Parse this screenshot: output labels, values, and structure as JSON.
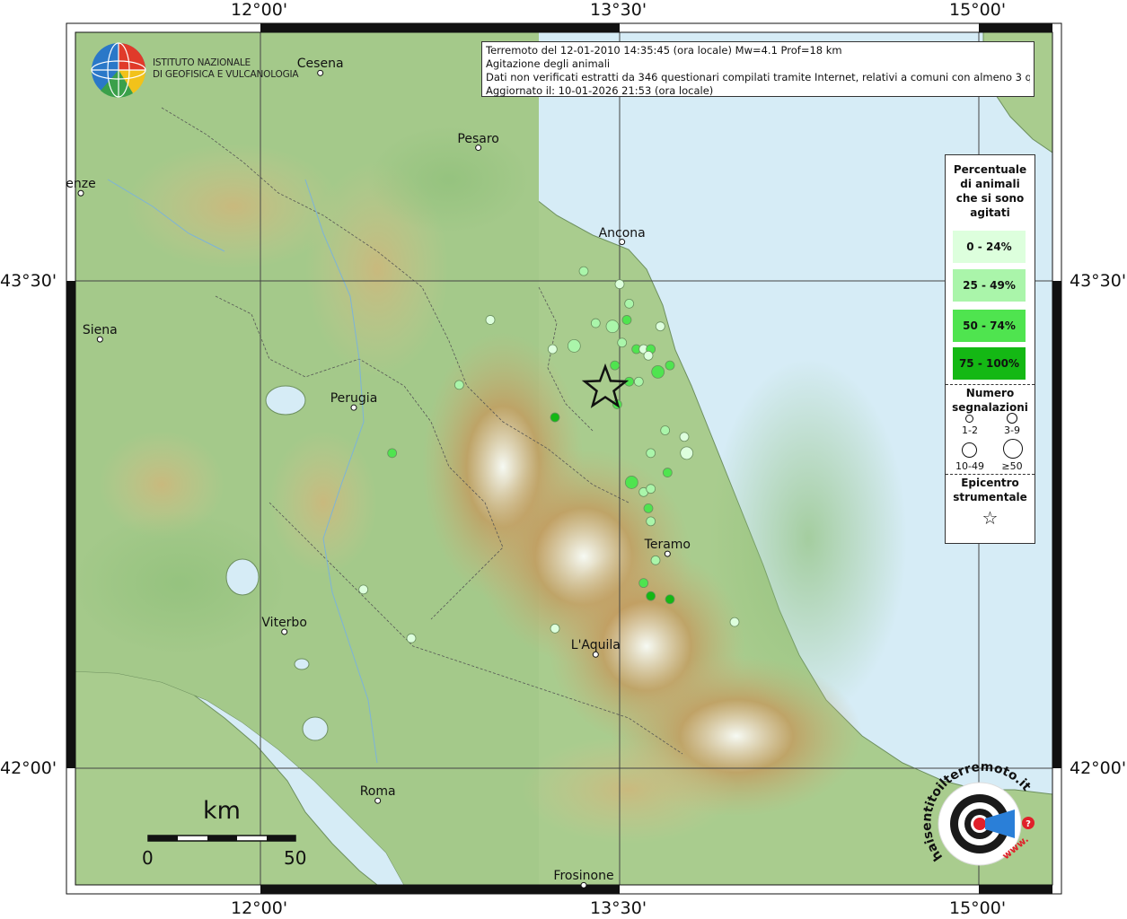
{
  "info": {
    "line1": "Terremoto del 12-01-2010 14:35:45 (ora locale) Mw=4.1 Prof=18 km",
    "line2": "Agitazione degli animali",
    "line3": "Dati non verificati estratti da 346 questionari compilati tramite Internet, relativi a comuni con almeno 3 questionari.",
    "line4": "Aggiornato il: 10-01-2026 21:53 (ora locale)"
  },
  "institute": {
    "line1": "ISTITUTO NAZIONALE",
    "line2": "DI GEOFISICA E VULCANOLOGIA"
  },
  "axes": {
    "top": [
      "12°00'",
      "13°30'",
      "15°00'"
    ],
    "bottom": [
      "12°00'",
      "13°30'",
      "15°00'"
    ],
    "left": [
      "43°30'",
      "42°00'"
    ],
    "right": [
      "43°30'",
      "42°00'"
    ]
  },
  "cities": [
    {
      "name": "Cesena",
      "lon": 12.25,
      "lat": 44.14
    },
    {
      "name": "Pesaro",
      "lon": 12.91,
      "lat": 43.91
    },
    {
      "name": "enze",
      "lon": 11.25,
      "lat": 43.77
    },
    {
      "name": "Ancona",
      "lon": 13.51,
      "lat": 43.62
    },
    {
      "name": "Siena",
      "lon": 11.33,
      "lat": 43.32
    },
    {
      "name": "Perugia",
      "lon": 12.39,
      "lat": 43.11
    },
    {
      "name": "Teramo",
      "lon": 13.7,
      "lat": 42.66
    },
    {
      "name": "Viterbo",
      "lon": 12.1,
      "lat": 42.42
    },
    {
      "name": "L'Aquila",
      "lon": 13.4,
      "lat": 42.35
    },
    {
      "name": "Roma",
      "lon": 12.49,
      "lat": 41.9
    },
    {
      "name": "Frosinone",
      "lon": 13.35,
      "lat": 41.64
    }
  ],
  "epicenter": {
    "lon": 13.44,
    "lat": 43.17
  },
  "observations": [
    {
      "lon": 13.35,
      "lat": 43.53,
      "cls": 1,
      "n": 2
    },
    {
      "lon": 13.5,
      "lat": 43.49,
      "cls": 0,
      "n": 1
    },
    {
      "lon": 13.54,
      "lat": 43.43,
      "cls": 1,
      "n": 1
    },
    {
      "lon": 12.96,
      "lat": 43.38,
      "cls": 0,
      "n": 1
    },
    {
      "lon": 13.4,
      "lat": 43.37,
      "cls": 1,
      "n": 1
    },
    {
      "lon": 13.47,
      "lat": 43.36,
      "cls": 1,
      "n": 3
    },
    {
      "lon": 13.53,
      "lat": 43.38,
      "cls": 2,
      "n": 1
    },
    {
      "lon": 13.67,
      "lat": 43.36,
      "cls": 0,
      "n": 1
    },
    {
      "lon": 13.31,
      "lat": 43.3,
      "cls": 1,
      "n": 3
    },
    {
      "lon": 13.22,
      "lat": 43.29,
      "cls": 0,
      "n": 1
    },
    {
      "lon": 13.51,
      "lat": 43.31,
      "cls": 1,
      "n": 1
    },
    {
      "lon": 13.57,
      "lat": 43.29,
      "cls": 2,
      "n": 1
    },
    {
      "lon": 13.6,
      "lat": 43.29,
      "cls": 0,
      "n": 1
    },
    {
      "lon": 13.63,
      "lat": 43.29,
      "cls": 2,
      "n": 1
    },
    {
      "lon": 13.62,
      "lat": 43.27,
      "cls": 0,
      "n": 1
    },
    {
      "lon": 13.48,
      "lat": 43.24,
      "cls": 2,
      "n": 1
    },
    {
      "lon": 13.66,
      "lat": 43.22,
      "cls": 2,
      "n": 3
    },
    {
      "lon": 13.71,
      "lat": 43.24,
      "cls": 2,
      "n": 1
    },
    {
      "lon": 12.83,
      "lat": 43.18,
      "cls": 1,
      "n": 1
    },
    {
      "lon": 13.54,
      "lat": 43.19,
      "cls": 2,
      "n": 1
    },
    {
      "lon": 13.58,
      "lat": 43.19,
      "cls": 1,
      "n": 1
    },
    {
      "lon": 13.49,
      "lat": 43.12,
      "cls": 2,
      "n": 1
    },
    {
      "lon": 13.23,
      "lat": 43.08,
      "cls": 3,
      "n": 1
    },
    {
      "lon": 13.69,
      "lat": 43.04,
      "cls": 1,
      "n": 1
    },
    {
      "lon": 13.77,
      "lat": 43.02,
      "cls": 0,
      "n": 1
    },
    {
      "lon": 12.55,
      "lat": 42.97,
      "cls": 2,
      "n": 1
    },
    {
      "lon": 13.63,
      "lat": 42.97,
      "cls": 1,
      "n": 1
    },
    {
      "lon": 13.78,
      "lat": 42.97,
      "cls": 0,
      "n": 3
    },
    {
      "lon": 13.7,
      "lat": 42.91,
      "cls": 2,
      "n": 1
    },
    {
      "lon": 13.55,
      "lat": 42.88,
      "cls": 2,
      "n": 3
    },
    {
      "lon": 13.6,
      "lat": 42.85,
      "cls": 1,
      "n": 1
    },
    {
      "lon": 13.63,
      "lat": 42.86,
      "cls": 1,
      "n": 1
    },
    {
      "lon": 13.62,
      "lat": 42.8,
      "cls": 2,
      "n": 1
    },
    {
      "lon": 13.63,
      "lat": 42.76,
      "cls": 1,
      "n": 1
    },
    {
      "lon": 13.65,
      "lat": 42.64,
      "cls": 1,
      "n": 1
    },
    {
      "lon": 12.43,
      "lat": 42.55,
      "cls": 0,
      "n": 1
    },
    {
      "lon": 13.6,
      "lat": 42.57,
      "cls": 2,
      "n": 1
    },
    {
      "lon": 13.63,
      "lat": 42.53,
      "cls": 3,
      "n": 1
    },
    {
      "lon": 13.71,
      "lat": 42.52,
      "cls": 3,
      "n": 1
    },
    {
      "lon": 13.98,
      "lat": 42.45,
      "cls": 0,
      "n": 1
    },
    {
      "lon": 13.23,
      "lat": 42.43,
      "cls": 0,
      "n": 1
    },
    {
      "lon": 12.63,
      "lat": 42.4,
      "cls": 0,
      "n": 1
    }
  ],
  "legend": {
    "title": "Percentuale di animali che si sono agitati",
    "classes": [
      {
        "label": "0 - 24%",
        "color": "#ddffdd"
      },
      {
        "label": "25 - 49%",
        "color": "#aaf5aa"
      },
      {
        "label": "50 - 74%",
        "color": "#4fe44f"
      },
      {
        "label": "75 - 100%",
        "color": "#14b814"
      }
    ],
    "count_title": "Numero segnalazioni",
    "sizes": [
      "1-2",
      "3-9",
      "10-49",
      "≥50"
    ],
    "epicenter_title": "Epicentro strumentale"
  },
  "scale": {
    "unit": "km",
    "min": "0",
    "max": "50"
  },
  "colors": {
    "sea": "#d6ecf6",
    "land": "#a9cc8e",
    "grid": "#444444"
  },
  "badge": {
    "text": "haisentitoilterremoto.it",
    "url_text": "www."
  }
}
